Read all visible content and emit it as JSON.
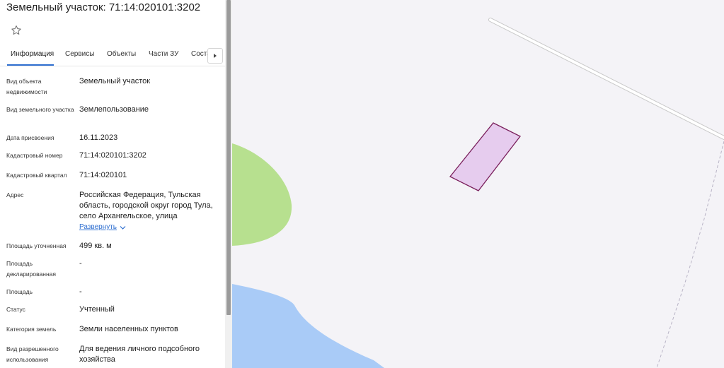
{
  "header": {
    "title": "Земельный участок: 71:14:020101:3202"
  },
  "tabs": [
    {
      "label": "Информация",
      "active": true
    },
    {
      "label": "Сервисы"
    },
    {
      "label": "Объекты"
    },
    {
      "label": "Части ЗУ"
    },
    {
      "label": "Состав"
    }
  ],
  "info": {
    "object_type": {
      "label": "Вид объекта недвижимости",
      "value": "Земельный участок"
    },
    "land_type": {
      "label": "Вид земельного участка",
      "value": "Землепользование"
    },
    "assign_date": {
      "label": "Дата присвоения",
      "value": "16.11.2023"
    },
    "cadastral_number": {
      "label": "Кадастровый номер",
      "value": "71:14:020101:3202"
    },
    "cadastral_quarter": {
      "label": "Кадастровый квартал",
      "value": "71:14:020101"
    },
    "address": {
      "label": "Адрес",
      "value": "Российская Федерация, Тульская область, городской округ город Тула, село Архангельское, улица",
      "expand_label": "Развернуть"
    },
    "area_refined": {
      "label": "Площадь уточненная",
      "value": "499 кв. м"
    },
    "area_declared": {
      "label": "Площадь декларированная",
      "value": "-"
    },
    "area": {
      "label": "Площадь",
      "value": "-"
    },
    "status": {
      "label": "Статус",
      "value": "Учтенный"
    },
    "land_category": {
      "label": "Категория земель",
      "value": "Земли населенных пунктов"
    },
    "permitted_use": {
      "label": "Вид разрешенного использования",
      "value": "Для ведения личного подсобного хозяйства"
    }
  },
  "colors": {
    "accent": "#2f6fd0",
    "parcel_fill": "#e6ccee",
    "parcel_stroke": "#7a1f5c",
    "green_area": "#b7e08f",
    "water": "#a9cbf7",
    "map_bg": "#f4f3f7"
  },
  "icons": {
    "favorite": "star-outline-icon",
    "tabs_scroll": "chevron-right-icon",
    "expand": "chevron-down-icon"
  }
}
